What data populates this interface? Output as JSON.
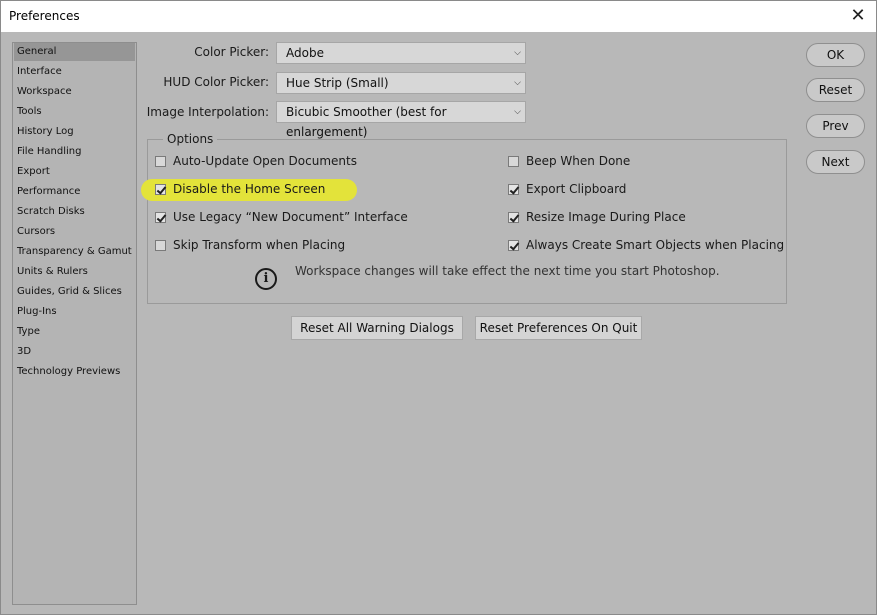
{
  "window": {
    "title": "Preferences",
    "close_glyph": "✕"
  },
  "sidebar": {
    "items": [
      {
        "label": "General",
        "selected": true
      },
      {
        "label": "Interface"
      },
      {
        "label": "Workspace"
      },
      {
        "label": "Tools"
      },
      {
        "label": "History Log"
      },
      {
        "label": "File Handling"
      },
      {
        "label": "Export"
      },
      {
        "label": "Performance"
      },
      {
        "label": "Scratch Disks"
      },
      {
        "label": "Cursors"
      },
      {
        "label": "Transparency & Gamut"
      },
      {
        "label": "Units & Rulers"
      },
      {
        "label": "Guides, Grid & Slices"
      },
      {
        "label": "Plug-Ins"
      },
      {
        "label": "Type"
      },
      {
        "label": "3D"
      },
      {
        "label": "Technology Previews"
      }
    ]
  },
  "fields": {
    "color_picker": {
      "label": "Color Picker:",
      "value": "Adobe"
    },
    "hud_color_picker": {
      "label": "HUD Color Picker:",
      "value": "Hue Strip (Small)"
    },
    "image_interpolation": {
      "label": "Image Interpolation:",
      "value": "Bicubic Smoother (best for enlargement)"
    }
  },
  "options": {
    "legend": "Options",
    "left": [
      {
        "label": "Auto-Update Open Documents",
        "checked": false
      },
      {
        "label": "Disable the Home Screen",
        "checked": true,
        "highlighted": true
      },
      {
        "label": "Use Legacy “New Document” Interface",
        "checked": true
      },
      {
        "label": "Skip Transform when Placing",
        "checked": false
      }
    ],
    "right": [
      {
        "label": "Beep When Done",
        "checked": false
      },
      {
        "label": "Export Clipboard",
        "checked": true
      },
      {
        "label": "Resize Image During Place",
        "checked": true
      },
      {
        "label": "Always Create Smart Objects when Placing",
        "checked": true
      }
    ],
    "info_text": "Workspace changes will take effect the next time you start Photoshop.",
    "info_icon_glyph": "i",
    "highlight_color": "#e3e33a"
  },
  "buttons": {
    "reset_warnings": "Reset All Warning Dialogs",
    "reset_on_quit": "Reset Preferences On Quit",
    "ok": "OK",
    "reset": "Reset",
    "prev": "Prev",
    "next": "Next"
  },
  "colors": {
    "dialog_bg": "#b8b8b8",
    "sidebar_selected": "#969696"
  }
}
